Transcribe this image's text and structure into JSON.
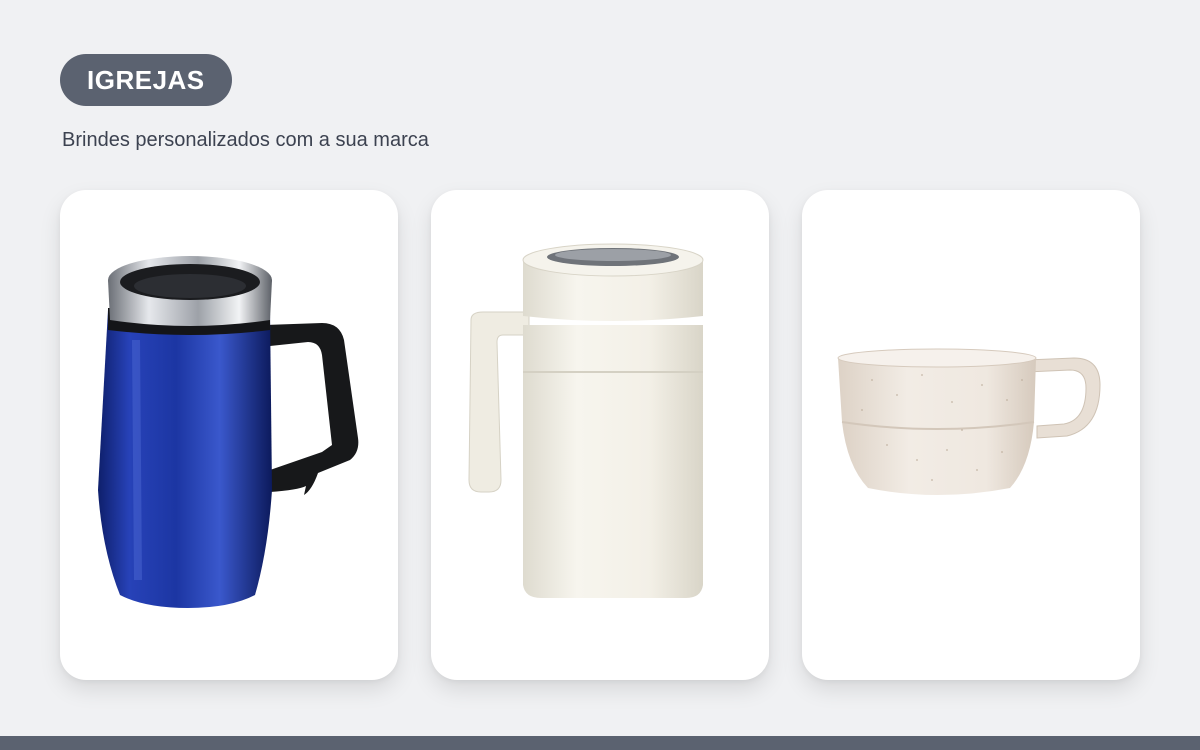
{
  "header": {
    "category_label": "IGREJAS",
    "subtitle": "Brindes personalizados com a sua marca"
  },
  "products": [
    {
      "image": "blue-steel-travel-mug-with-black-handle",
      "color": "#1f3a9e"
    },
    {
      "image": "cream-thermal-mug-with-lid",
      "color": "#f1eee4"
    },
    {
      "image": "speckled-beige-cup",
      "color": "#ece3d9"
    }
  ],
  "colors": {
    "background": "#f0f1f3",
    "accent": "#5b6270",
    "text": "#3c4250",
    "card": "#ffffff"
  }
}
